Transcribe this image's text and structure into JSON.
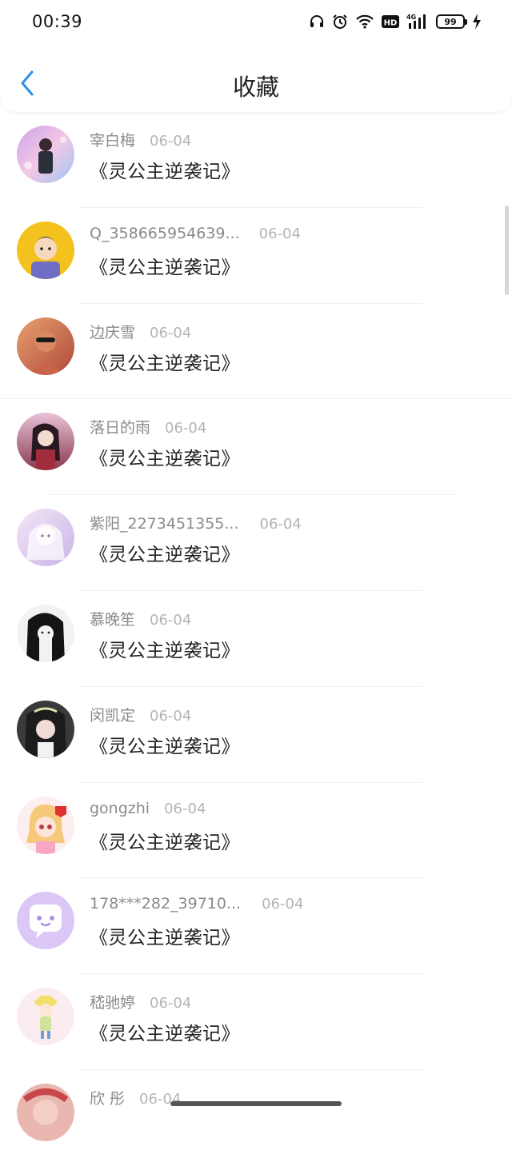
{
  "status_bar": {
    "time": "00:39",
    "network": "4G",
    "battery": "99"
  },
  "header": {
    "title": "收藏"
  },
  "favorites": [
    {
      "username": "宰白梅",
      "date": "06-04",
      "book": "《灵公主逆袭记》"
    },
    {
      "username": "Q_358665954639...",
      "date": "06-04",
      "book": "《灵公主逆袭记》"
    },
    {
      "username": "边庆雪",
      "date": "06-04",
      "book": "《灵公主逆袭记》"
    },
    {
      "username": "落日的雨",
      "date": "06-04",
      "book": "《灵公主逆袭记》"
    },
    {
      "username": "紫阳_2273451355...",
      "date": "06-04",
      "book": "《灵公主逆袭记》"
    },
    {
      "username": "慕晚笙",
      "date": "06-04",
      "book": "《灵公主逆袭记》"
    },
    {
      "username": "闵凯定",
      "date": "06-04",
      "book": "《灵公主逆袭记》"
    },
    {
      "username": "gongzhi",
      "date": "06-04",
      "book": "《灵公主逆袭记》"
    },
    {
      "username": "178***282_39710...",
      "date": "06-04",
      "book": "《灵公主逆袭记》"
    },
    {
      "username": "嵇驰婷",
      "date": "06-04",
      "book": "《灵公主逆袭记》"
    },
    {
      "username": "欣 彤",
      "date": "06-04",
      "book": ""
    }
  ]
}
